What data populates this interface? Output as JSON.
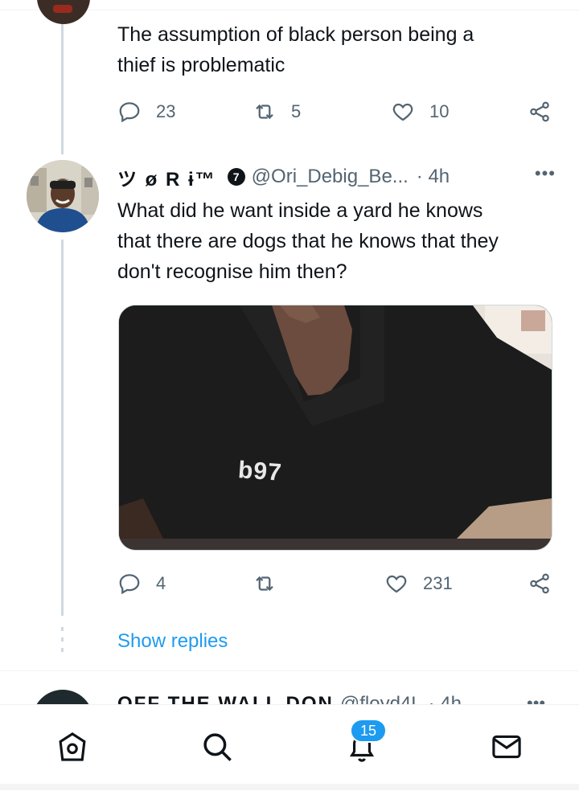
{
  "tweet1": {
    "text_lines": [
      "The assumption of black person being a",
      "thief is problematic"
    ],
    "replies": "23",
    "retweets": "5",
    "likes": "10"
  },
  "tweet2": {
    "display_name": "ツ ø R ɨ™",
    "verified_badge": "7",
    "handle": "@Ori_Debig_Be...",
    "time": "· 4h",
    "more": "•••",
    "text_lines": [
      "What did he want inside a yard he knows",
      "that there are dogs that he knows that they",
      "don't recognise him then?"
    ],
    "media_logo_text": "b97",
    "replies": "4",
    "retweets": "",
    "likes": "231"
  },
  "show_replies_label": "Show replies",
  "tweet3_partial": {
    "display_name": "OFF THE WALL DON",
    "handle": "@floyd4L",
    "time": "· 4h",
    "more": "•••"
  },
  "navbar": {
    "notifications_count": "15",
    "items": [
      "home-icon",
      "search-icon",
      "notifications-icon",
      "messages-icon"
    ]
  },
  "colors": {
    "accent": "#1d9bf0",
    "secondary_text": "#536471",
    "thread_line": "#cfd9de"
  }
}
